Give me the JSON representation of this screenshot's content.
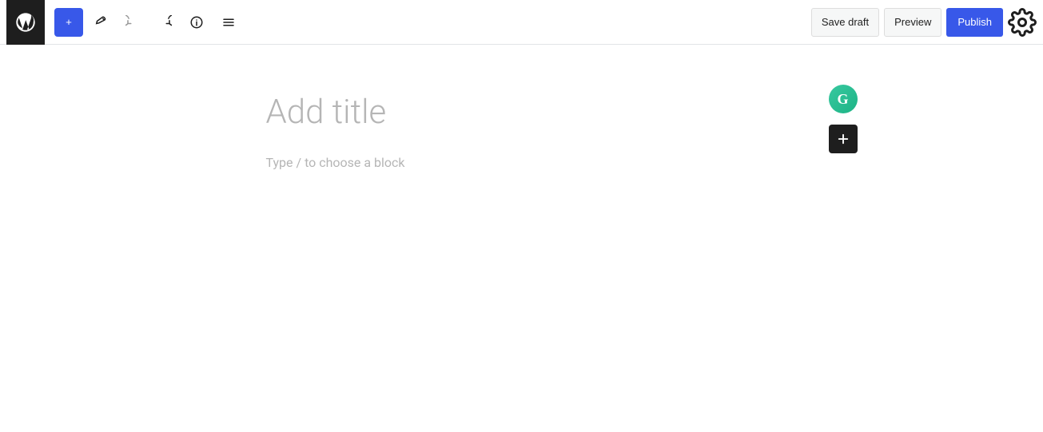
{
  "toolbar": {
    "wp_logo_label": "WordPress",
    "add_block_label": "+",
    "tools_label": "Tools",
    "undo_label": "Undo",
    "redo_label": "Redo",
    "info_label": "Details",
    "list_view_label": "List View",
    "save_draft_label": "Save draft",
    "preview_label": "Preview",
    "publish_label": "Publish",
    "settings_label": "Settings"
  },
  "editor": {
    "title_placeholder": "Add title",
    "block_placeholder": "Type / to choose a block"
  },
  "grammarly": {
    "letter": "G"
  },
  "add_block": {
    "label": "+"
  }
}
